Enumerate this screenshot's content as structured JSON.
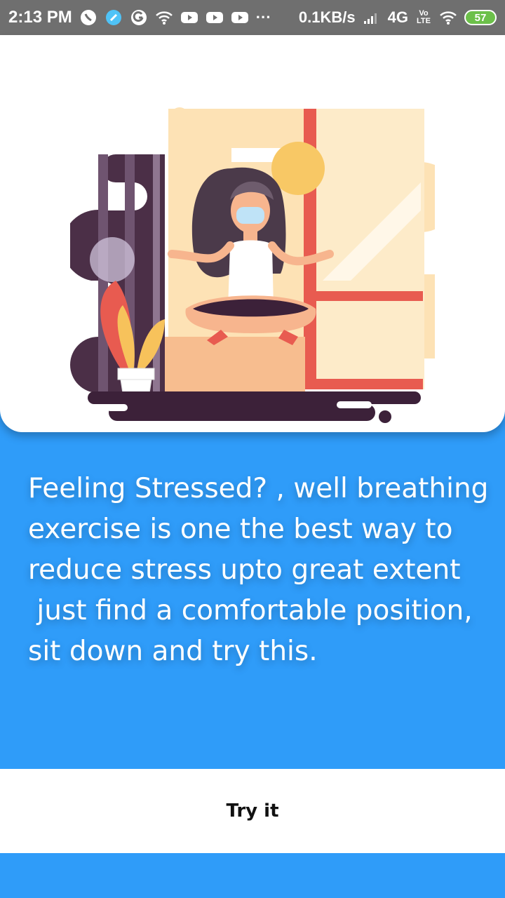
{
  "status_bar": {
    "time": "2:13 PM",
    "network_speed": "0.1KB/s",
    "signal": "4G",
    "volte": "Vo LTE",
    "battery": "57",
    "overflow": "···"
  },
  "content": {
    "message": "Feeling Stressed? , well breathing exercise is one the best way to reduce stress upto great extent\n just find a comfortable position,  sit down and try this."
  },
  "action": {
    "try_label": "Try it"
  },
  "colors": {
    "primary": "#2f9cf9",
    "status_bar": "#6f6f6f",
    "card": "#ffffff"
  },
  "icons": [
    "whatsapp-icon",
    "app-icon",
    "google-icon",
    "wifi-icon",
    "youtube-icon",
    "signal-icon",
    "battery-icon"
  ]
}
